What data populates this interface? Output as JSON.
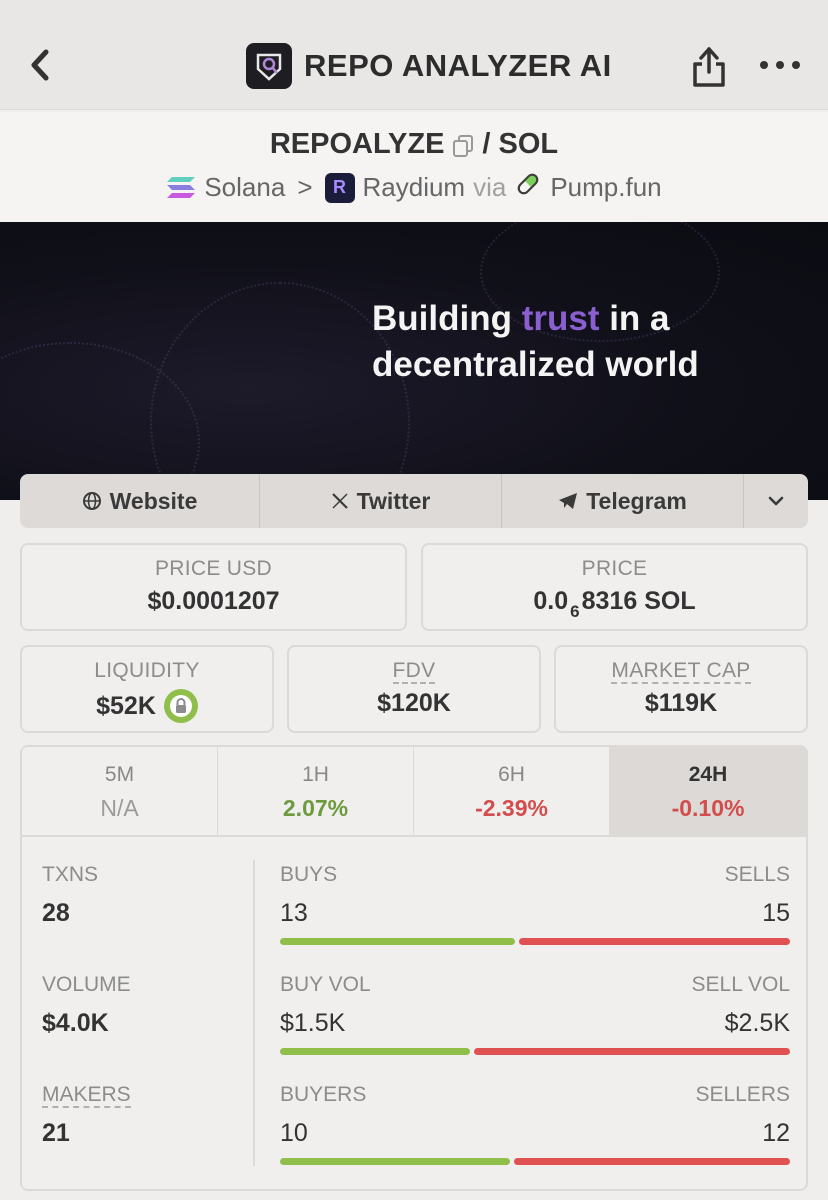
{
  "header": {
    "app_title": "REPO ANALYZER AI",
    "back_icon": "chevron-left-icon",
    "share_icon": "share-icon",
    "more_icon": "more-horizontal-icon"
  },
  "pair": {
    "base": "REPOALYZE",
    "quote": "/ SOL",
    "chain": "Solana",
    "separator": ">",
    "dex": "Raydium",
    "via": "via",
    "launchpad": "Pump.fun"
  },
  "banner": {
    "line1_pre": "Building ",
    "line1_accent": "trust",
    "line1_post": " in a",
    "line2": "decentralized world"
  },
  "links": {
    "website": "Website",
    "twitter": "Twitter",
    "telegram": "Telegram"
  },
  "stats": {
    "price_usd_label": "PRICE USD",
    "price_usd": "$0.0001207",
    "price_label": "PRICE",
    "price_prefix": "0.0",
    "price_zeros": "6",
    "price_suffix": "8316 SOL",
    "liquidity_label": "LIQUIDITY",
    "liquidity": "$52K",
    "fdv_label": "FDV",
    "fdv": "$120K",
    "mcap_label": "MARKET CAP",
    "mcap": "$119K"
  },
  "timeframes": [
    {
      "label": "5M",
      "value": "N/A"
    },
    {
      "label": "1H",
      "value": "2.07%"
    },
    {
      "label": "6H",
      "value": "-2.39%"
    },
    {
      "label": "24H",
      "value": "-0.10%"
    }
  ],
  "metrics": {
    "txns_label": "TXNS",
    "txns": "28",
    "volume_label": "VOLUME",
    "volume": "$4.0K",
    "makers_label": "MAKERS",
    "makers": "21",
    "buys_label": "BUYS",
    "buys": "13",
    "sells_label": "SELLS",
    "sells": "15",
    "buyvol_label": "BUY VOL",
    "buyvol": "$1.5K",
    "sellvol_label": "SELL VOL",
    "sellvol": "$2.5K",
    "buyers_label": "BUYERS",
    "buyers": "10",
    "sellers_label": "SELLERS",
    "sellers": "12",
    "buys_ratio": 0.464,
    "buyvol_ratio": 0.375,
    "buyers_ratio": 0.455
  },
  "colors": {
    "positive": "#6c9a3c",
    "negative": "#d34d4d",
    "buy_bar": "#8fbf4a",
    "sell_bar": "#e05252",
    "accent": "#8a5fd0"
  }
}
